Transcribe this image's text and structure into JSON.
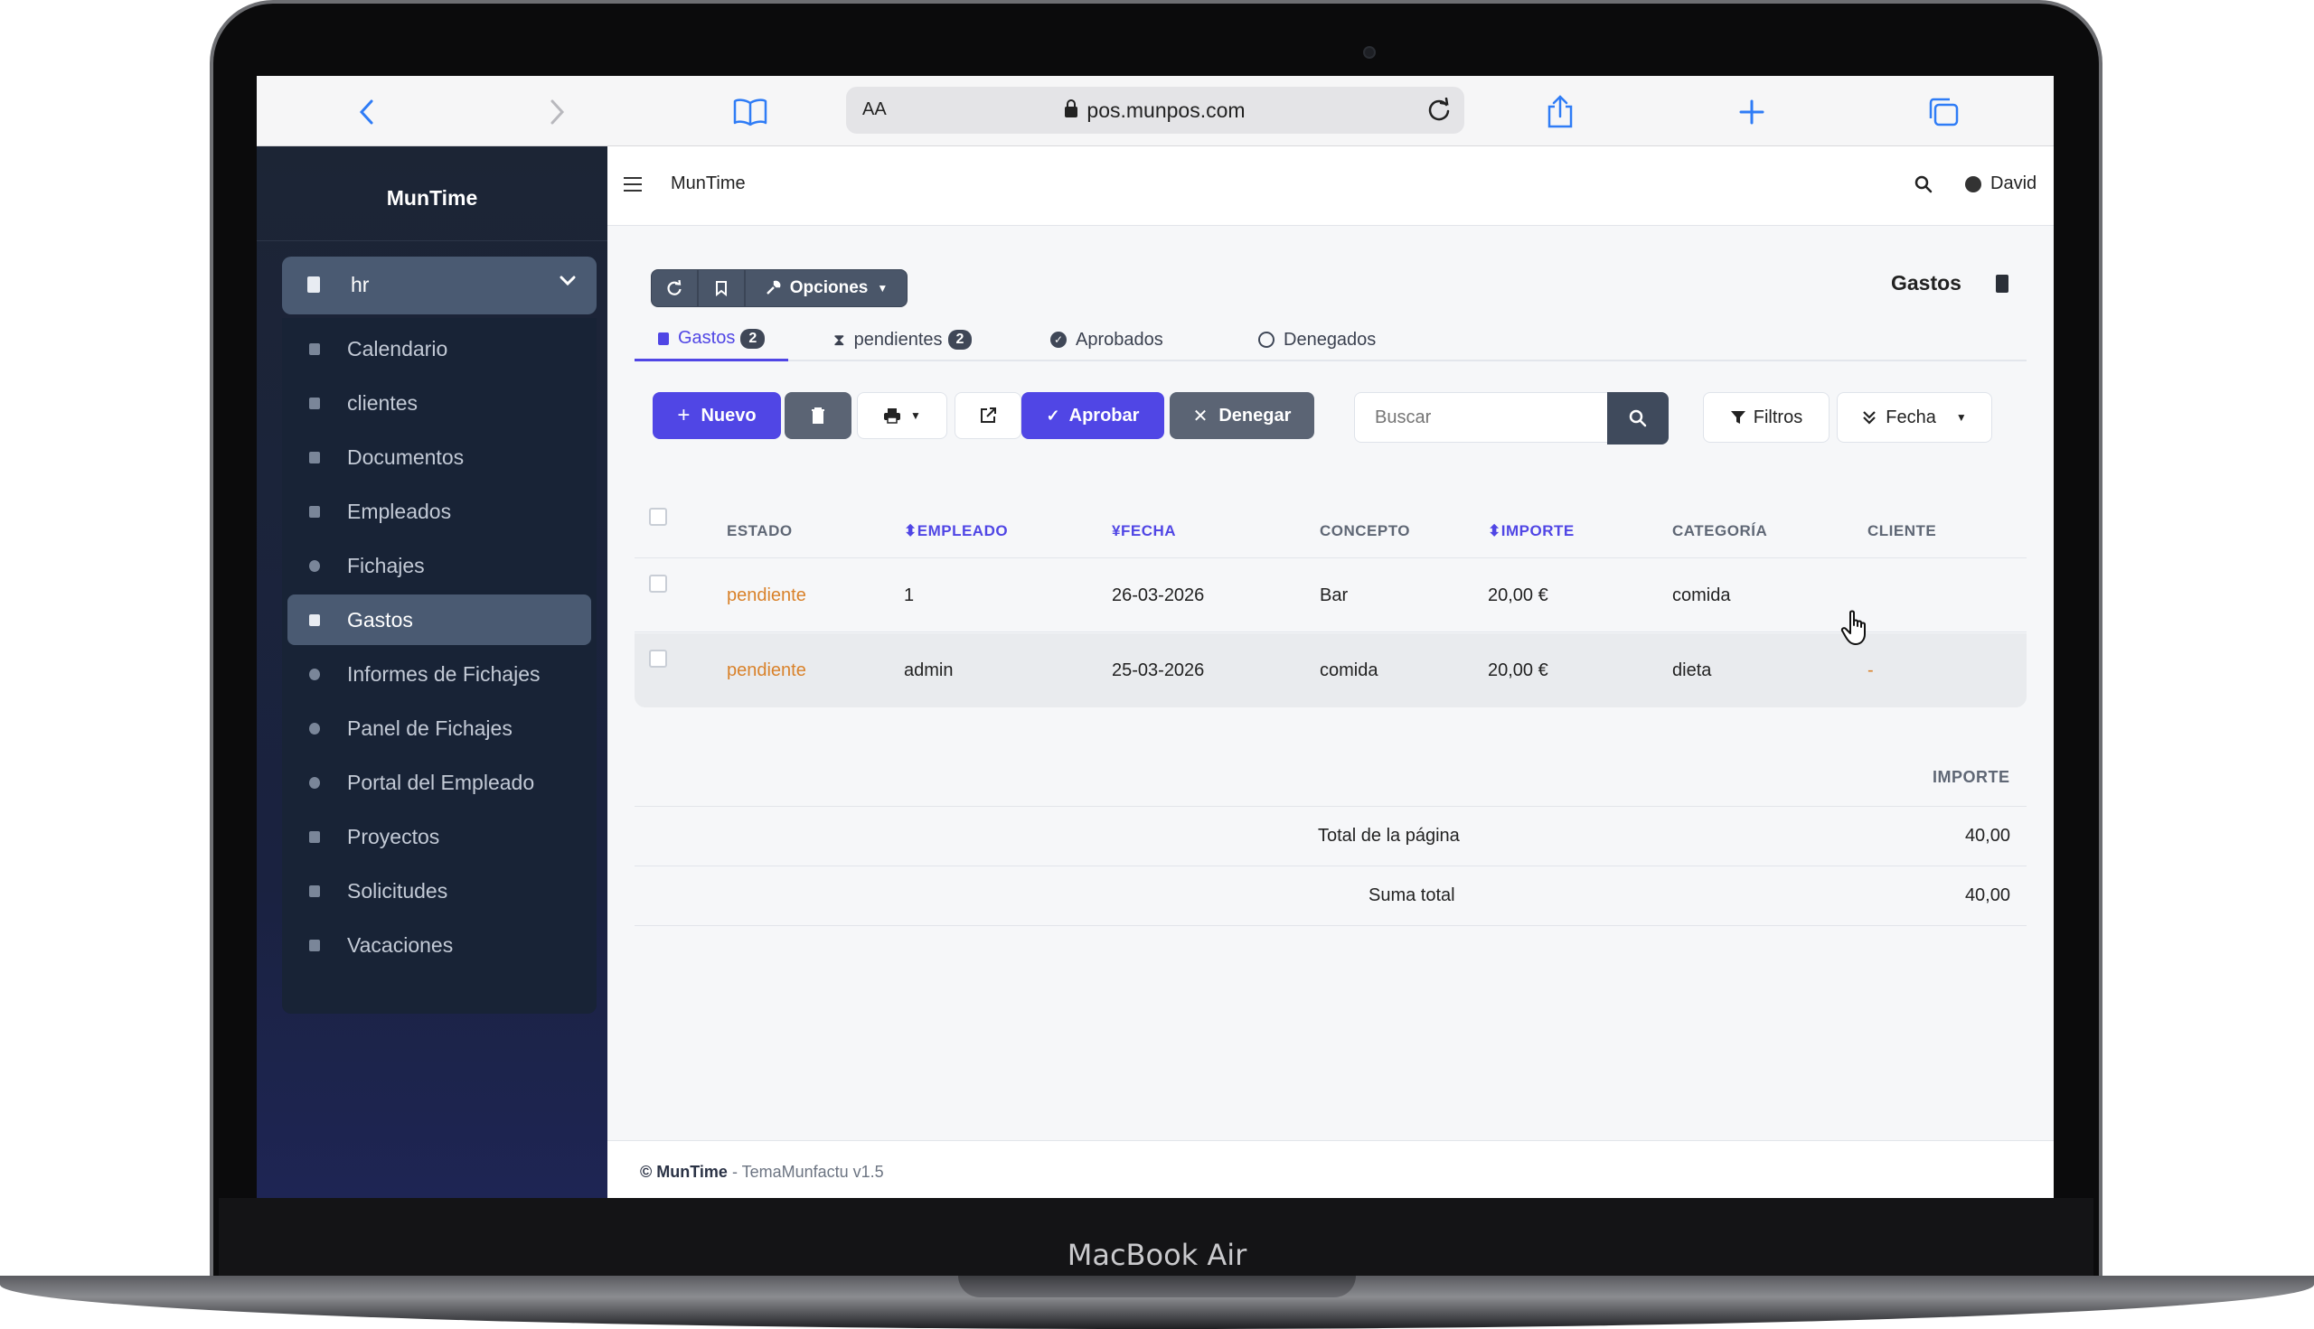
{
  "device": {
    "label": "MacBook Air"
  },
  "browser": {
    "text_size": "AA",
    "url": "pos.munpos.com"
  },
  "sidebar": {
    "brand": "MunTime",
    "module": "hr",
    "items": [
      {
        "label": "Calendario",
        "icon": "calendar-icon"
      },
      {
        "label": "clientes",
        "icon": "building-icon"
      },
      {
        "label": "Documentos",
        "icon": "file-icon"
      },
      {
        "label": "Empleados",
        "icon": "id-card-icon"
      },
      {
        "label": "Fichajes",
        "icon": "clock-icon"
      },
      {
        "label": "Gastos",
        "icon": "receipt-icon",
        "active": true
      },
      {
        "label": "Informes de Fichajes",
        "icon": "chart-pie-icon"
      },
      {
        "label": "Panel de Fichajes",
        "icon": "palette-icon"
      },
      {
        "label": "Portal del Empleado",
        "icon": "palette-icon"
      },
      {
        "label": "Proyectos",
        "icon": "project-diagram-icon"
      },
      {
        "label": "Solicitudes",
        "icon": "paper-plane-icon"
      },
      {
        "label": "Vacaciones",
        "icon": "umbrella-beach-icon"
      }
    ]
  },
  "topbar": {
    "title": "MunTime",
    "user": "David"
  },
  "view": {
    "title": "Gastos",
    "options_label": "Opciones"
  },
  "tabs": [
    {
      "label": "Gastos",
      "badge": "2",
      "icon": "receipt-icon"
    },
    {
      "label": "pendientes",
      "badge": "2",
      "icon": "hourglass-icon"
    },
    {
      "label": "Aprobados",
      "icon": "check-circle-icon"
    },
    {
      "label": "Denegados",
      "icon": "ban-icon"
    }
  ],
  "actions": {
    "new": "Nuevo",
    "approve": "Aprobar",
    "deny": "Denegar",
    "search_placeholder": "Buscar",
    "filters": "Filtros",
    "order": "Fecha"
  },
  "table": {
    "columns": [
      "ESTADO",
      "EMPLEADO",
      "FECHA",
      "CONCEPTO",
      "IMPORTE",
      "CATEGORÍA",
      "CLIENTE"
    ],
    "rows": [
      {
        "estado": "pendiente",
        "empleado": "1",
        "fecha": "26-03-2026",
        "concepto": "Bar",
        "importe": "20,00 €",
        "categoria": "comida",
        "cliente": ""
      },
      {
        "estado": "pendiente",
        "empleado": "admin",
        "fecha": "25-03-2026",
        "concepto": "comida",
        "importe": "20,00 €",
        "categoria": "dieta",
        "cliente": "-"
      }
    ]
  },
  "totals": {
    "header": "IMPORTE",
    "page_label": "Total de la página",
    "page_value": "40,00",
    "sum_label": "Suma total",
    "sum_value": "40,00"
  },
  "footer": {
    "brand": "© MunTime",
    "suffix": " - TemaMunfactu v1.5"
  },
  "colors": {
    "accent": "#5046e5",
    "sidebar": "#1c2535",
    "pending": "#d9822b"
  }
}
